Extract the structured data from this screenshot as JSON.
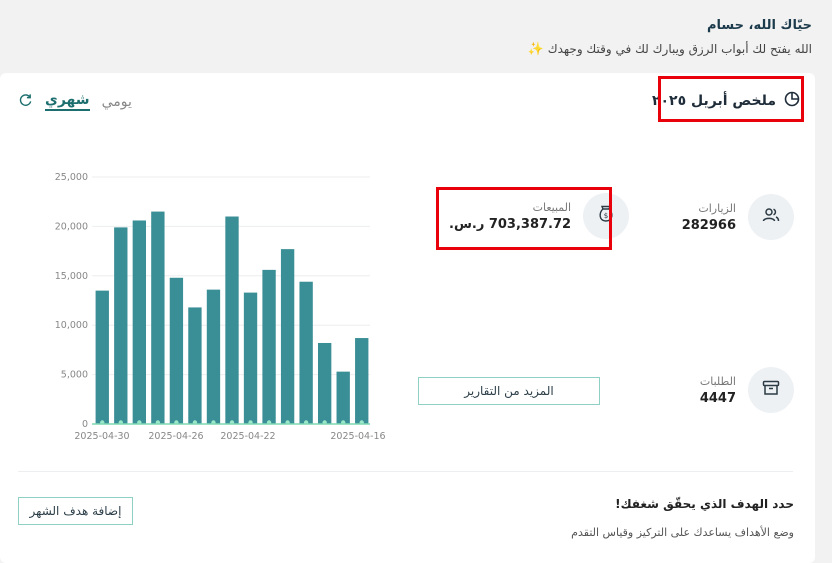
{
  "greeting": {
    "hello": "حيّاك الله، حسام",
    "subtitle": "الله يفتح لك أبواب الرزق ويبارك لك في وقتك وجهدك"
  },
  "summary": {
    "title": "ملخص أبريل ٢٠٢٥",
    "tabs": [
      "شهري",
      "يومي"
    ],
    "active_tab": "شهري"
  },
  "stats": {
    "visits": {
      "label": "الزيارات",
      "value": "282966"
    },
    "sales": {
      "label": "المبيعات",
      "value": "703,387.72 ر.س."
    },
    "orders": {
      "label": "الطلبات",
      "value": "4447"
    }
  },
  "more_reports_label": "المزيد من التقارير",
  "goal": {
    "title": "حدد الهدف الذي يحقّق شغفك!",
    "subtitle": "وضع الأهداف يساعدك على التركيز وقياس التقدم",
    "button_label": "إضافة هدف الشهر"
  },
  "colors": {
    "bar": "#3a8e96",
    "accent": "#1d6e6e",
    "highlight": "#e8000b"
  },
  "chart_data": {
    "type": "bar",
    "y_ticks": [
      "25,000",
      "20,000",
      "15,000",
      "10,000",
      "5,000",
      "0"
    ],
    "ylim": [
      0,
      25000
    ],
    "x_tick_labels": [
      "2025-04-30",
      "2025-04-26",
      "2025-04-22",
      "2025-04-16"
    ],
    "values": [
      13500,
      19900,
      20600,
      21500,
      14800,
      11800,
      13600,
      21000,
      13300,
      15600,
      17700,
      14400,
      8200,
      5300,
      8700
    ],
    "grid": true
  }
}
